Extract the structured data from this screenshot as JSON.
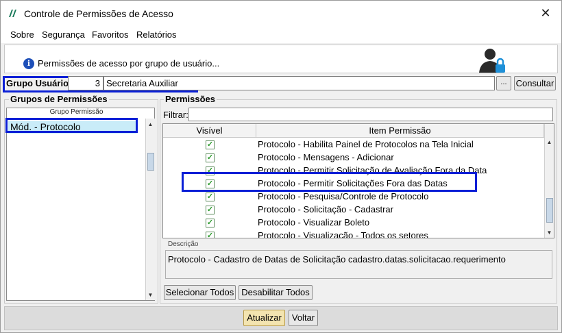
{
  "window": {
    "title": "Controle de Permissões de Acesso",
    "close_glyph": "✕"
  },
  "menu": [
    {
      "label": "Sobre"
    },
    {
      "label": "Segurança"
    },
    {
      "label": "Favoritos"
    },
    {
      "label": "Relatórios"
    }
  ],
  "info": {
    "text": "Permissões de acesso por grupo de usuário...",
    "icon": "info-icon",
    "right_icon": "user-lock-icon"
  },
  "group_user": {
    "label": "Grupo Usuário:",
    "number": "3",
    "name": "Secretaria Auxiliar",
    "ellipsis": "...",
    "consult_label": "Consultar"
  },
  "groups_panel": {
    "title": "Grupos de Permissões",
    "column_header": "Grupo Permissão",
    "items": [
      "Mód. - Protocolo"
    ]
  },
  "perms_panel": {
    "title": "Permissões",
    "filter_label": "Filtrar:",
    "filter_value": "",
    "columns": [
      "Visível",
      "Item Permissão"
    ],
    "rows": [
      {
        "checked": true,
        "text": "Protocolo - Habilita Painel de Protocolos na Tela Inicial"
      },
      {
        "checked": true,
        "text": "Protocolo - Mensagens - Adicionar"
      },
      {
        "checked": true,
        "text": "Protocolo - Permitir Solicitação de Avaliação Fora da Data"
      },
      {
        "checked": true,
        "text": "Protocolo - Permitir Solicitações Fora das Datas"
      },
      {
        "checked": true,
        "text": "Protocolo - Pesquisa/Controle de Protocolo"
      },
      {
        "checked": true,
        "text": "Protocolo - Solicitação - Cadastrar"
      },
      {
        "checked": true,
        "text": "Protocolo - Visualizar Boleto"
      },
      {
        "checked": true,
        "text": "Protocolo - Visualização - Todos os setores"
      }
    ],
    "description_label": "Descrição",
    "description_text": "Protocolo - Cadastro de Datas de Solicitação cadastro.datas.solicitacao.requerimento",
    "select_all_label": "Selecionar Todos",
    "disable_all_label": "Desabilitar Todos"
  },
  "footer": {
    "update_label": "Atualizar",
    "back_label": "Voltar"
  },
  "colors": {
    "highlight_border": "#0a1fd6",
    "selected_item": "#c9ecf8",
    "check_green": "#2b9a2b",
    "update_button": "#f3e4b0"
  }
}
